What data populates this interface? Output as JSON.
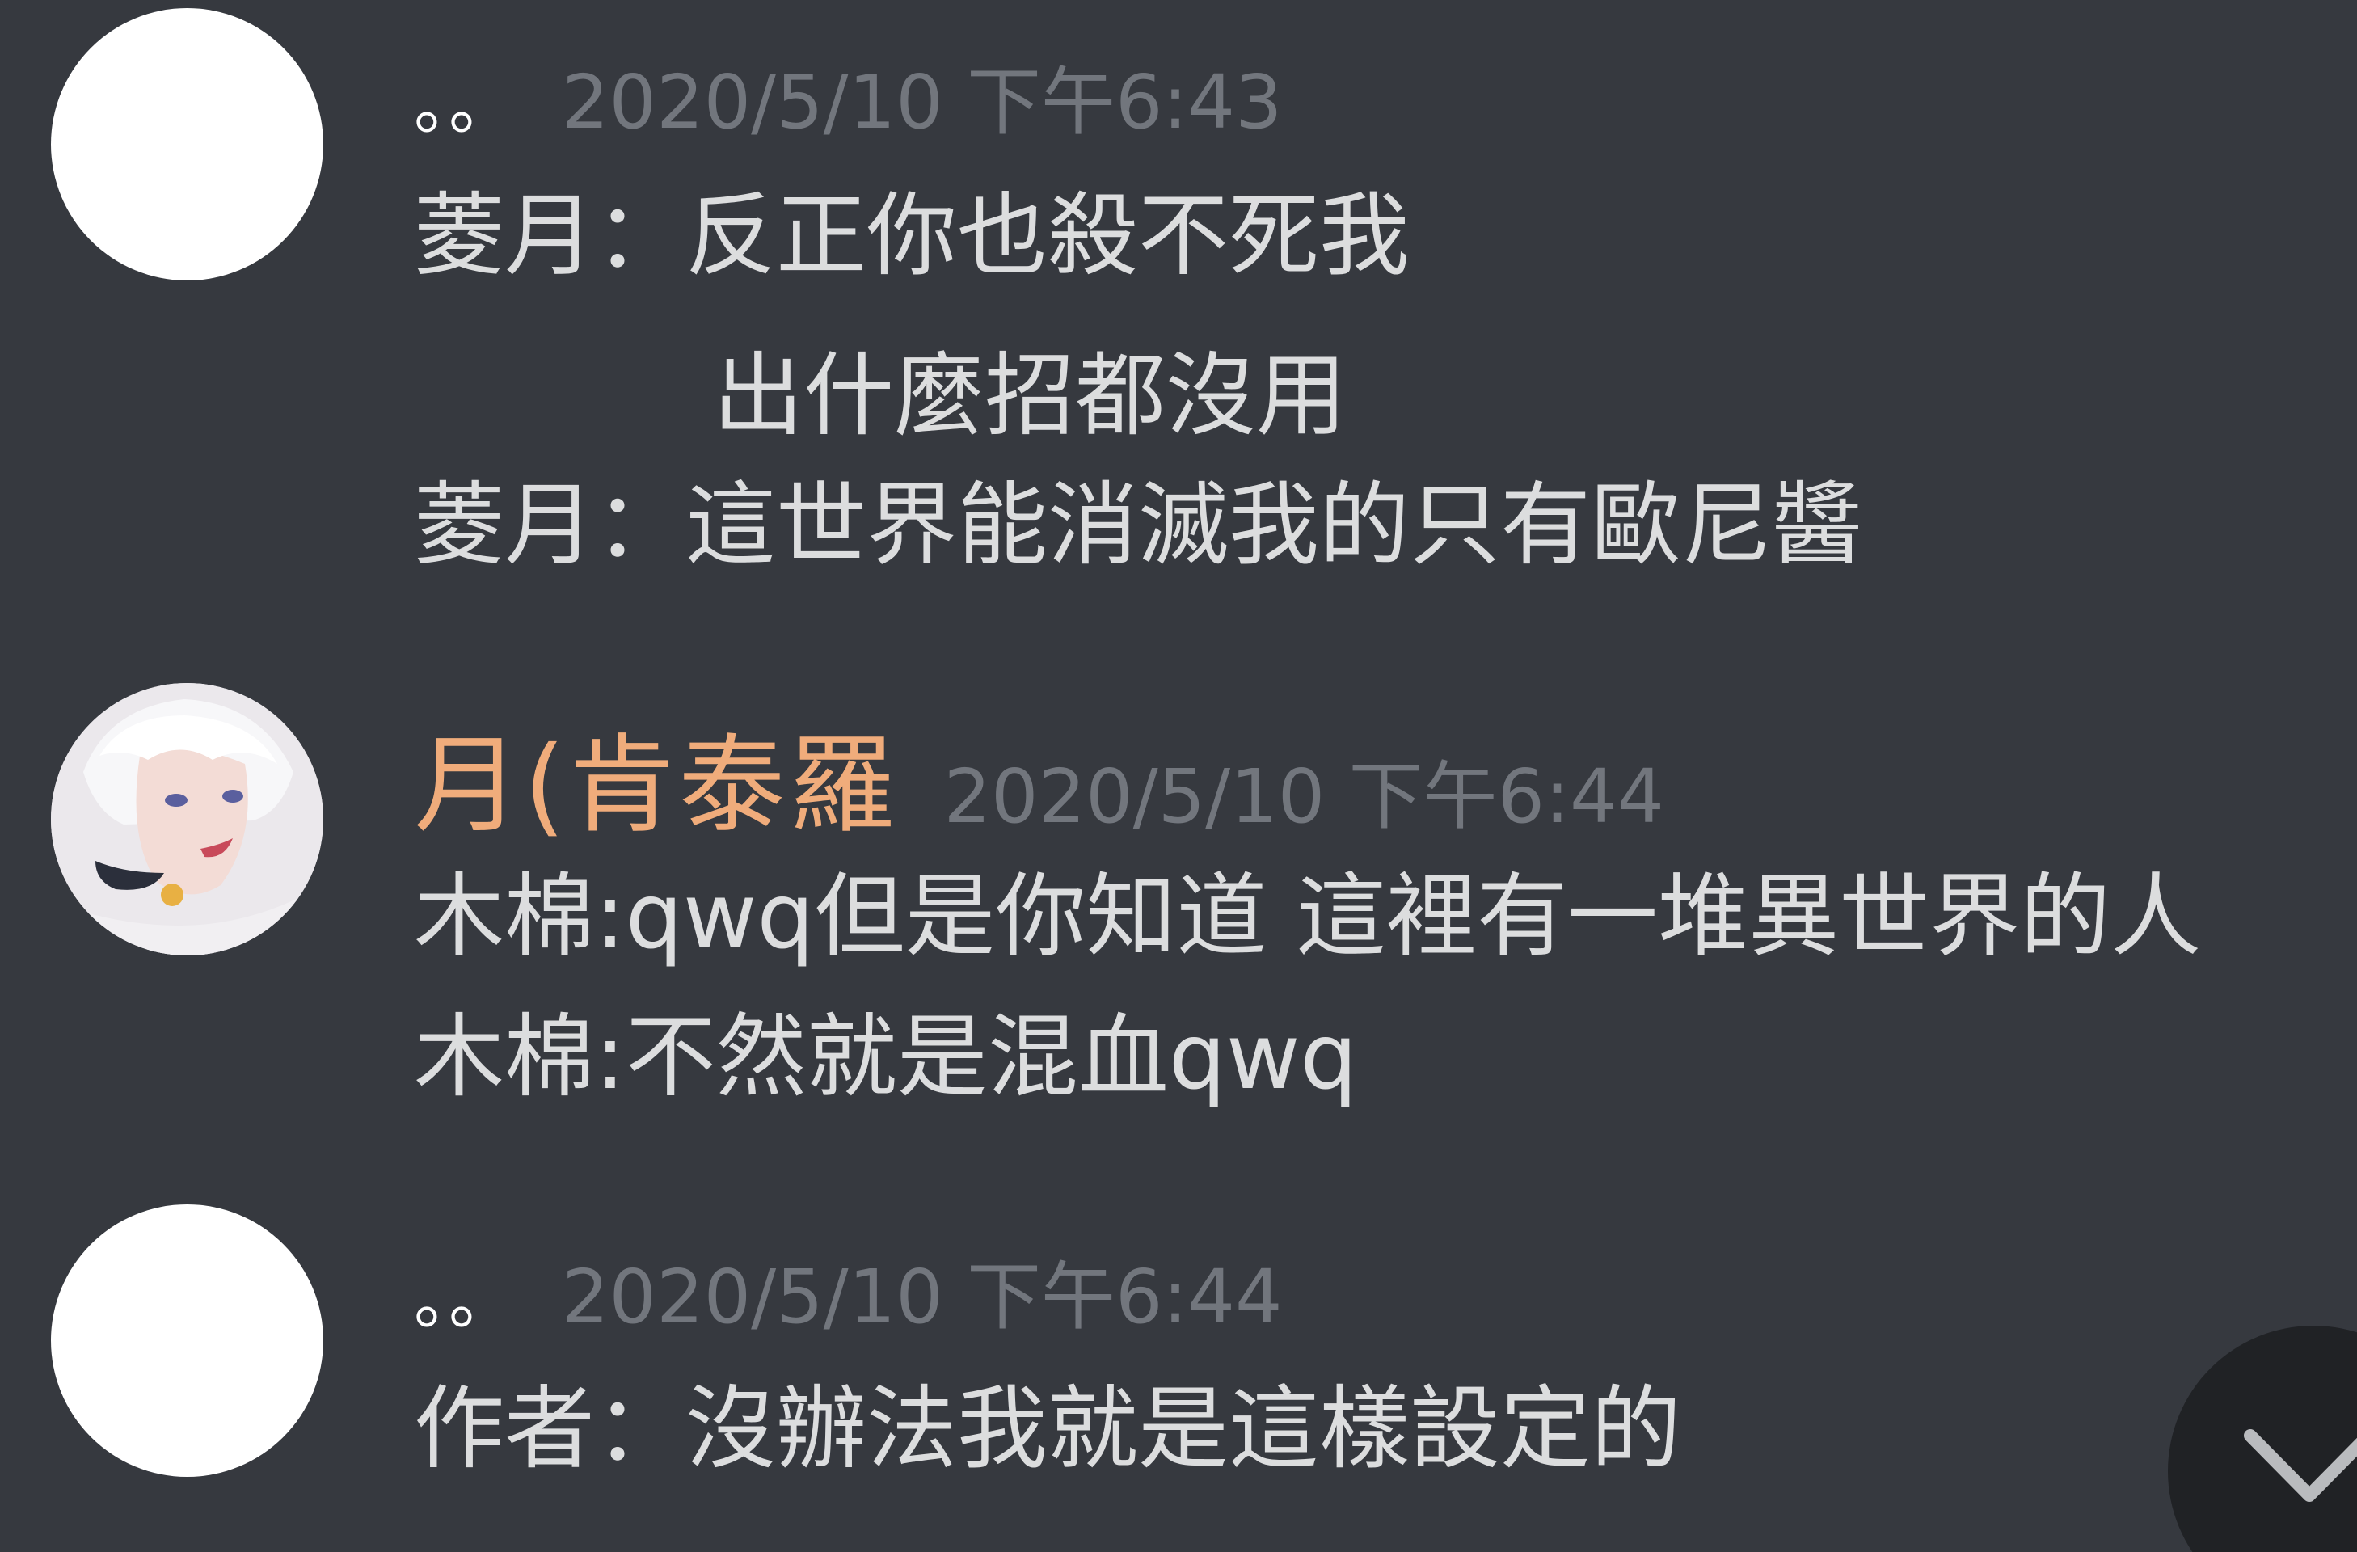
{
  "messages": [
    {
      "author": "。。",
      "timestamp": "2020/5/10 下午6:43",
      "lines": [
        "菱月：反正你也殺不死我",
        "出什麼招都沒用",
        "菱月：這世界能消滅我的只有歐尼醬"
      ]
    },
    {
      "author": "月(肯泰羅",
      "author_color": "#f0ac7b",
      "timestamp": "2020/5/10 下午6:44",
      "lines": [
        "木棉:qwq但是你知道 這裡有一堆異世界的人",
        "木棉:不然就是混血qwq"
      ]
    },
    {
      "author": "。。",
      "timestamp": "2020/5/10 下午6:44",
      "lines": [
        "作者：沒辦法我就是這樣設定的"
      ]
    }
  ],
  "jump_button_icon": "chevron-down-icon"
}
